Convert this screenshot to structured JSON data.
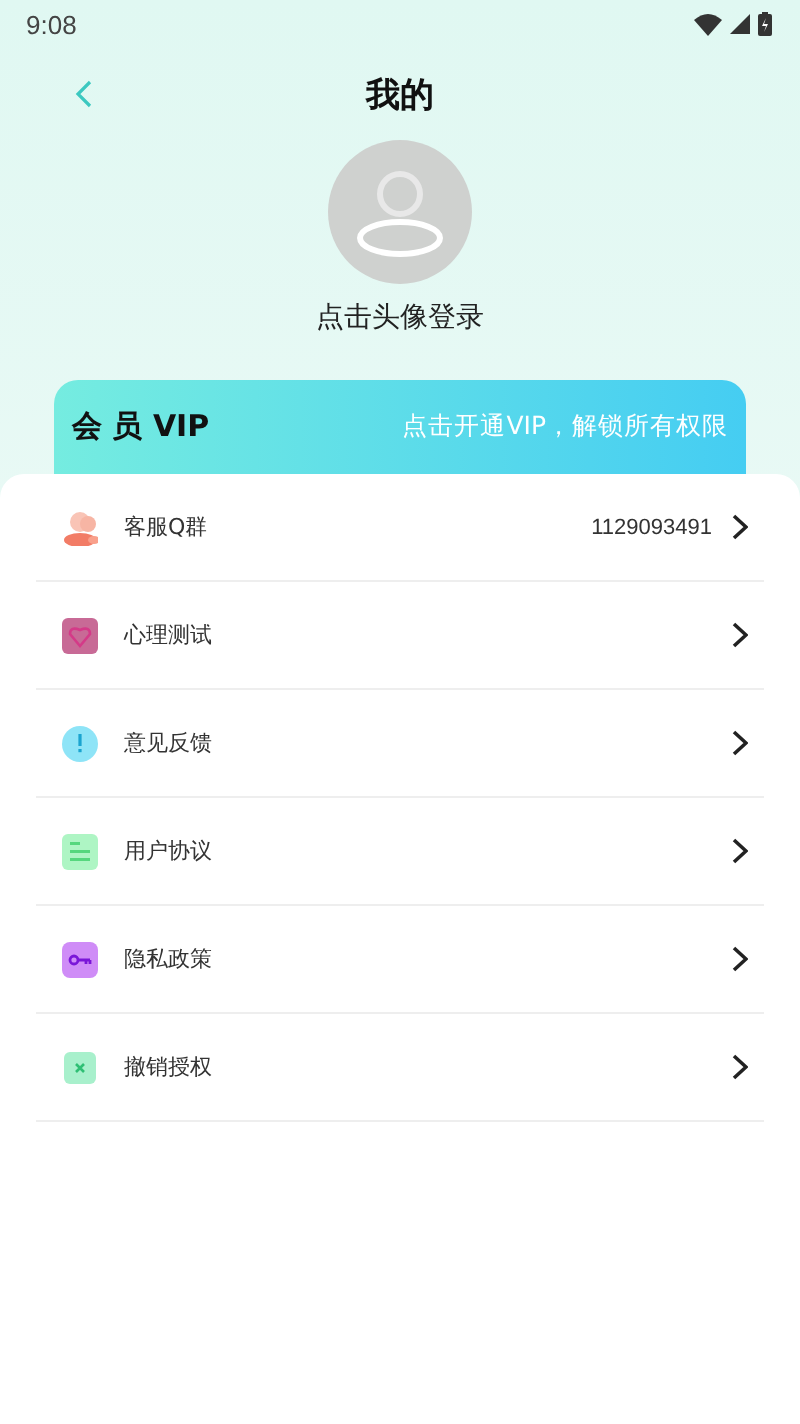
{
  "status_bar": {
    "time": "9:08"
  },
  "header": {
    "title": "我的"
  },
  "profile": {
    "login_text": "点击头像登录"
  },
  "vip_card": {
    "title": "会 员 VIP",
    "subtitle": "点击开通VIP，解锁所有权限"
  },
  "menu": [
    {
      "kind": "group",
      "label": "客服Q群",
      "value": "1129093491"
    },
    {
      "kind": "heart",
      "label": "心理测试"
    },
    {
      "kind": "alert",
      "label": "意见反馈"
    },
    {
      "kind": "document",
      "label": "用户协议"
    },
    {
      "kind": "key",
      "label": "隐私政策"
    },
    {
      "kind": "cross",
      "label": "撤销授权"
    }
  ]
}
